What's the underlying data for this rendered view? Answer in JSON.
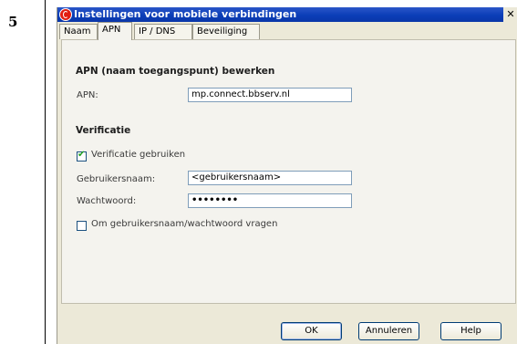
{
  "step": {
    "number": "5"
  },
  "window": {
    "title": "Instellingen voor mobiele verbindingen",
    "close_label": "✕"
  },
  "tabs": [
    {
      "label": "Naam",
      "active": false
    },
    {
      "label": "APN",
      "active": true
    },
    {
      "label": "IP / DNS",
      "active": false
    },
    {
      "label": "Beveiliging",
      "active": false
    }
  ],
  "apn_section": {
    "heading": "APN (naam toegangspunt) bewerken",
    "apn_label": "APN:",
    "apn_value": "mp.connect.bbserv.nl"
  },
  "verification": {
    "heading": "Verificatie",
    "use_verification_label": "Verificatie gebruiken",
    "use_verification_checked": true,
    "username_label": "Gebruikersnaam:",
    "username_value": "<gebruikersnaam>",
    "password_label": "Wachtwoord:",
    "password_value": "••••••••",
    "ask_credentials_label": "Om gebruikersnaam/wachtwoord vragen",
    "ask_credentials_checked": false
  },
  "buttons": {
    "ok": "OK",
    "cancel": "Annuleren",
    "help": "Help"
  },
  "colors": {
    "titlebar": "#0b3eb8",
    "dialog_bg": "#ece9d8",
    "panel_bg": "#f4f3ee",
    "field_border": "#7f9db9"
  }
}
